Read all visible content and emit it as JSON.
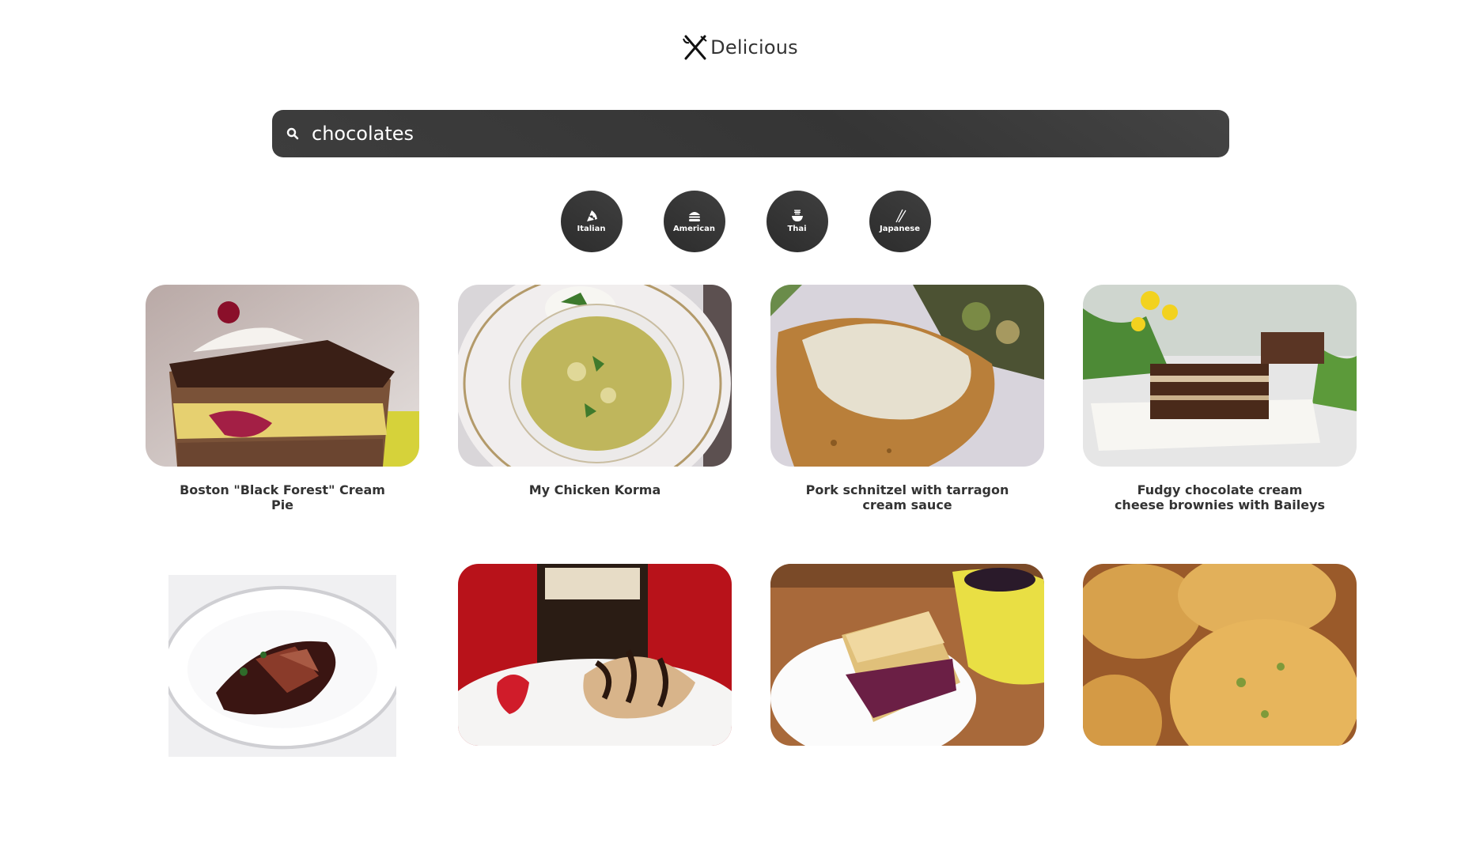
{
  "app": {
    "logo_text": "Delicious",
    "logo_icon": "fork-knife-icon"
  },
  "search": {
    "value": "chocolates",
    "placeholder": "",
    "icon": "search-icon"
  },
  "cuisines": [
    {
      "label": "Italian",
      "icon": "pizza-icon"
    },
    {
      "label": "American",
      "icon": "burger-icon"
    },
    {
      "label": "Thai",
      "icon": "noodle-bowl-icon"
    },
    {
      "label": "Japanese",
      "icon": "chopsticks-icon"
    }
  ],
  "recipes": [
    {
      "title": "Boston \"Black Forest\" Cream Pie"
    },
    {
      "title": "My Chicken Korma"
    },
    {
      "title": "Pork schnitzel with tarragon cream sauce"
    },
    {
      "title": "Fudgy chocolate cream cheese brownies with Baileys"
    },
    {
      "title": ""
    },
    {
      "title": ""
    },
    {
      "title": ""
    },
    {
      "title": ""
    }
  ],
  "colors": {
    "search_bg": "#3a3a3a",
    "circle_bg": "#333333",
    "text": "#333333"
  }
}
